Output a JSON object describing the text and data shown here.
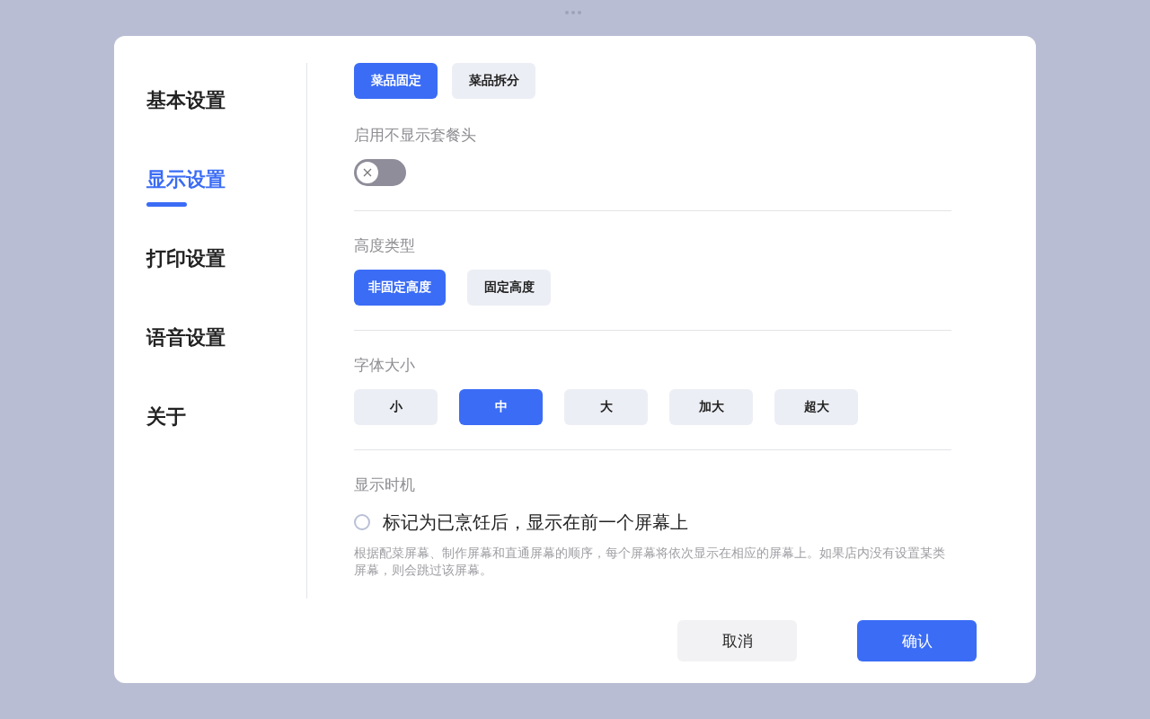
{
  "sidebar": {
    "items": [
      {
        "label": "基本设置",
        "selected": false
      },
      {
        "label": "显示设置",
        "selected": true
      },
      {
        "label": "打印设置",
        "selected": false
      },
      {
        "label": "语音设置",
        "selected": false
      },
      {
        "label": "关于",
        "selected": false
      }
    ]
  },
  "groups": [
    {
      "blocks": [
        {
          "kind": "options",
          "options": [
            {
              "label": "菜品固定",
              "selected": true
            },
            {
              "label": "菜品拆分",
              "selected": false
            }
          ]
        },
        {
          "kind": "toggle",
          "title": "启用不显示套餐头",
          "on": false
        }
      ]
    },
    {
      "blocks": [
        {
          "kind": "options",
          "title": "高度类型",
          "options": [
            {
              "label": "非固定高度",
              "selected": true
            },
            {
              "label": "固定高度",
              "selected": false
            }
          ]
        }
      ]
    },
    {
      "blocks": [
        {
          "kind": "options",
          "title": "字体大小",
          "options": [
            {
              "label": "小",
              "selected": false
            },
            {
              "label": "中",
              "selected": true
            },
            {
              "label": "大",
              "selected": false
            },
            {
              "label": "加大",
              "selected": false
            },
            {
              "label": "超大",
              "selected": false
            }
          ]
        }
      ]
    },
    {
      "blocks": [
        {
          "kind": "radio",
          "title": "显示时机",
          "label": "标记为已烹饪后，显示在前一个屏幕上",
          "selected": false,
          "description": "根据配菜屏幕、制作屏幕和直通屏幕的顺序，每个屏幕将依次显示在相应的屏幕上。如果店内没有设置某类屏幕，则会跳过该屏幕。"
        }
      ]
    }
  ],
  "buttons": [
    {
      "label": "取消",
      "kind": "secondary"
    },
    {
      "label": "确认",
      "kind": "primary"
    }
  ]
}
